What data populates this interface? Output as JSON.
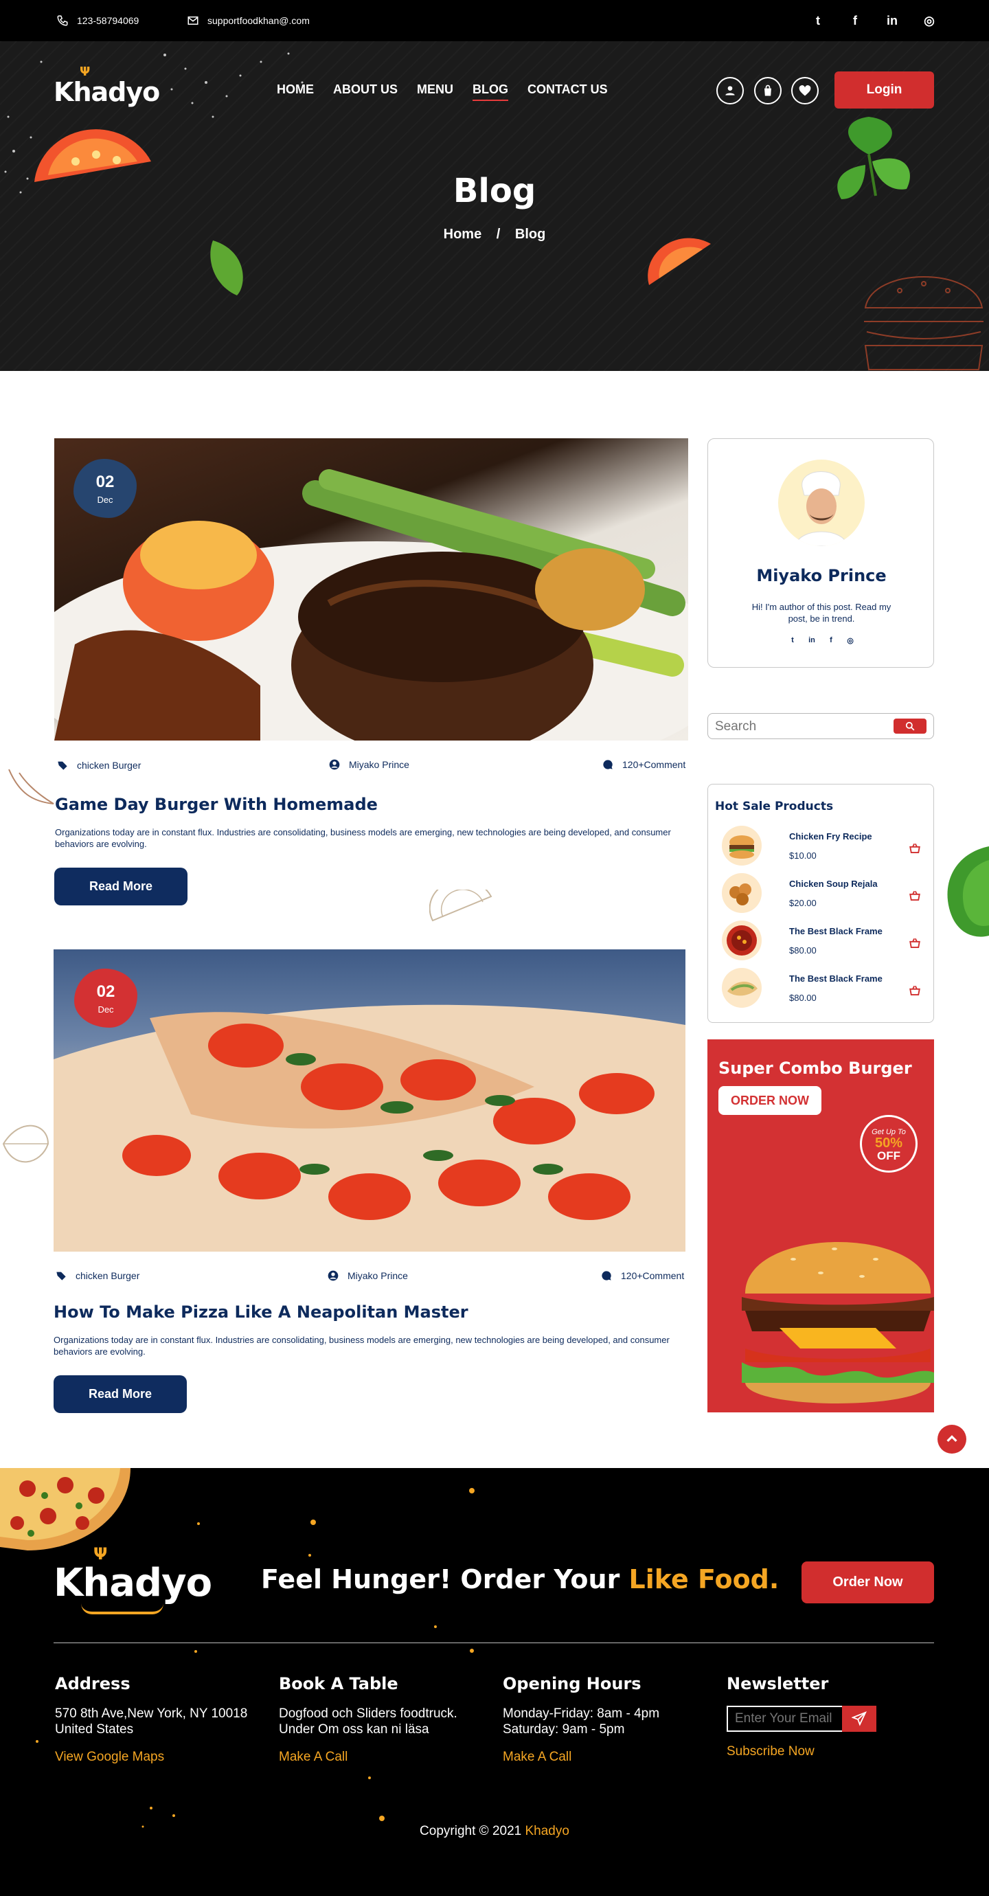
{
  "topbar": {
    "phone": "123-58794069",
    "email": "supportfoodkhan@.com",
    "social": [
      {
        "icon": "twitter-icon",
        "glyph": "t"
      },
      {
        "icon": "facebook-icon",
        "glyph": "f"
      },
      {
        "icon": "linkedin-icon",
        "glyph": "in"
      },
      {
        "icon": "instagram-icon",
        "glyph": "◎"
      }
    ]
  },
  "header": {
    "logo": "Khadyo",
    "nav": [
      "HOME",
      "ABOUT US",
      "MENU",
      "BLOG",
      "CONTACT US"
    ],
    "active_nav": "BLOG",
    "login": "Login"
  },
  "hero": {
    "title": "Blog",
    "breadcrumb": [
      "Home",
      "/",
      "Blog"
    ]
  },
  "posts": [
    {
      "date_day": "02",
      "date_month": "Dec",
      "category": "chicken Burger",
      "author": "Miyako Prince",
      "comments": "120+Comment",
      "title": "Game Day Burger With Homemade",
      "description": "Organizations today are in constant flux. Industries are consolidating, business models are emerging, new technologies are being developed, and consumer behaviors are evolving.",
      "button": "Read More"
    },
    {
      "date_day": "02",
      "date_month": "Dec",
      "category": "chicken Burger",
      "author": "Miyako Prince",
      "comments": "120+Comment",
      "title": "How To Make Pizza Like A Neapolitan Master",
      "description": "Organizations today are in constant flux. Industries are consolidating, business models are emerging, new technologies are being developed, and consumer behaviors are evolving.",
      "button": "Read More"
    }
  ],
  "author": {
    "name": "Miyako Prince",
    "bio": "Hi! I'm author of this post. Read my post, be in trend."
  },
  "search": {
    "placeholder": "Search"
  },
  "hot_sale": {
    "title": "Hot Sale Products",
    "products": [
      {
        "name": "Chicken Fry Recipe",
        "price": "$10.00"
      },
      {
        "name": "Chicken Soup Rejala",
        "price": "$20.00"
      },
      {
        "name": "The Best Black Frame",
        "price": "$80.00"
      },
      {
        "name": "The Best Black Frame",
        "price": "$80.00"
      }
    ]
  },
  "promo": {
    "title": "Super Combo Burger",
    "button": "ORDER NOW",
    "badge_small": "Get Up To",
    "badge_percent": "50%",
    "badge_off": "OFF"
  },
  "footer": {
    "logo": "Khadyo",
    "tagline_start": "Feel Hunger! Order Your ",
    "tagline_highlight": "Like Food.",
    "order_button": "Order Now",
    "address": {
      "heading": "Address",
      "text": "570 8th Ave,New York, NY 10018 United States",
      "link": "View Google Maps"
    },
    "book": {
      "heading": "Book A Table",
      "text": "Dogfood och Sliders foodtruck. Under Om oss kan ni läsa",
      "link": "Make A Call"
    },
    "hours": {
      "heading": "Opening Hours",
      "line1": "Monday-Friday: 8am - 4pm",
      "line2": "Saturday: 9am - 5pm",
      "link": "Make A Call"
    },
    "newsletter": {
      "heading": "Newsletter",
      "placeholder": "Enter Your Email",
      "link": "Subscribe Now"
    },
    "copyright_prefix": "Copyright",
    "copyright_year": "2021",
    "copyright_brand": "Khadyo"
  },
  "colors": {
    "primary_red": "#d12e2e",
    "navy": "#0d2a5c",
    "accent_orange": "#f5a623",
    "dark": "#000000"
  }
}
